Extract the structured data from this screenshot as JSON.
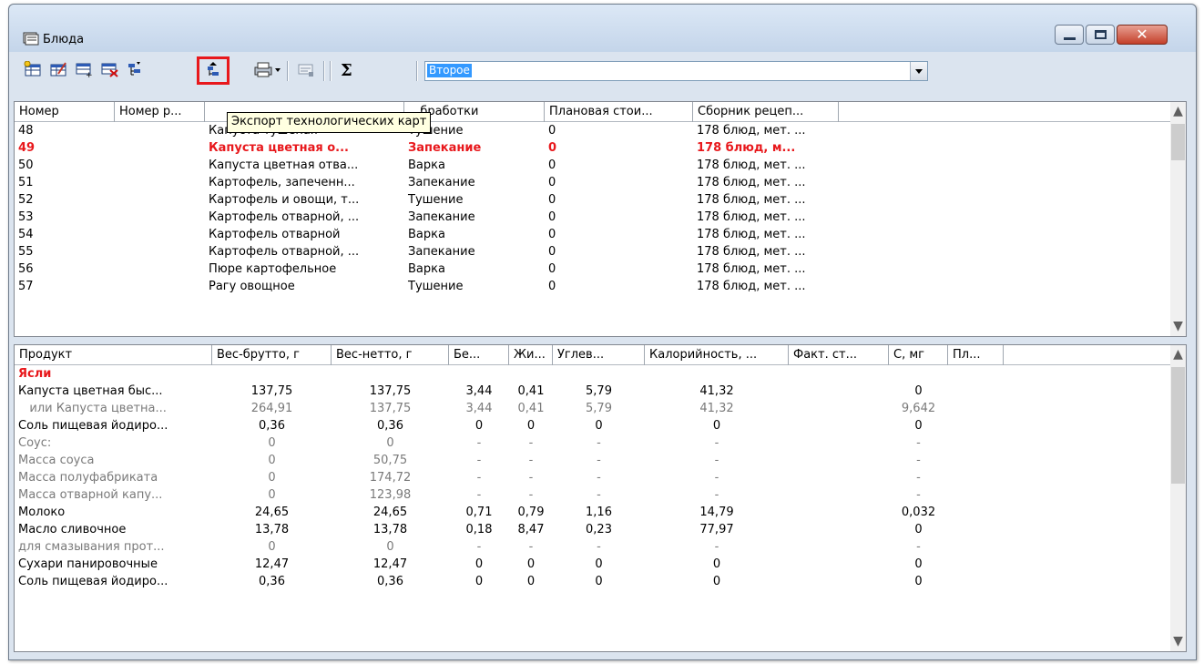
{
  "window": {
    "title": "Блюда",
    "controls": {
      "minimize": "–",
      "maximize": "▫",
      "close": "✕"
    }
  },
  "toolbar": {
    "buttons": [
      {
        "name": "add-dish",
        "icon": "table-add-icon"
      },
      {
        "name": "edit-dish",
        "icon": "table-edit-icon"
      },
      {
        "name": "add-row",
        "icon": "grid-add-icon"
      },
      {
        "name": "delete-dish",
        "icon": "grid-delete-icon"
      },
      {
        "name": "import",
        "icon": "tree-import-icon"
      },
      {
        "name": "export-tech-cards",
        "icon": "tree-export-icon",
        "highlighted": true
      },
      {
        "name": "print",
        "icon": "printer-icon"
      },
      {
        "name": "preview",
        "icon": "preview-icon"
      },
      {
        "name": "sum",
        "icon": "sigma-icon"
      }
    ],
    "filter_combo": {
      "value": "Второе"
    }
  },
  "tooltip": "Экспорт технологических карт",
  "dishes_grid": {
    "columns": [
      "Номер",
      "Номер р...",
      "",
      "...бработки",
      "Плановая стои...",
      "Сборник рецеп..."
    ],
    "rows": [
      {
        "num": "48",
        "rnum": "",
        "name": "Капуста тушеная",
        "method": "Тушение",
        "cost": "0",
        "book": "178 блюд, мет. ...",
        "style": ""
      },
      {
        "num": "49",
        "rnum": "",
        "name": "Капуста цветная о...",
        "method": "Запекание",
        "cost": "0",
        "book": "178 блюд, м...",
        "style": "red"
      },
      {
        "num": "50",
        "rnum": "",
        "name": "Капуста цветная отва...",
        "method": "Варка",
        "cost": "0",
        "book": "178 блюд, мет. ...",
        "style": ""
      },
      {
        "num": "51",
        "rnum": "",
        "name": "Картофель, запеченн...",
        "method": "Запекание",
        "cost": "0",
        "book": "178 блюд, мет. ...",
        "style": ""
      },
      {
        "num": "52",
        "rnum": "",
        "name": "Картофель и овощи, т...",
        "method": "Тушение",
        "cost": "0",
        "book": "178 блюд, мет. ...",
        "style": ""
      },
      {
        "num": "53",
        "rnum": "",
        "name": "Картофель отварной, ...",
        "method": "Запекание",
        "cost": "0",
        "book": "178 блюд, мет. ...",
        "style": ""
      },
      {
        "num": "54",
        "rnum": "",
        "name": "Картофель отварной",
        "method": "Варка",
        "cost": "0",
        "book": "178 блюд, мет. ...",
        "style": ""
      },
      {
        "num": "55",
        "rnum": "",
        "name": "Картофель отварной, ...",
        "method": "Запекание",
        "cost": "0",
        "book": "178 блюд, мет. ...",
        "style": ""
      },
      {
        "num": "56",
        "rnum": "",
        "name": "Пюре картофельное",
        "method": "Варка",
        "cost": "0",
        "book": "178 блюд, мет. ...",
        "style": ""
      },
      {
        "num": "57",
        "rnum": "",
        "name": "Рагу овощное",
        "method": "Тушение",
        "cost": "0",
        "book": "178 блюд, мет. ...",
        "style": ""
      }
    ]
  },
  "products_grid": {
    "columns": [
      "Продукт",
      "Вес-брутто, г",
      "Вес-нетто, г",
      "Бе...",
      "Жи...",
      "Углев...",
      "Калорийность, ...",
      "Факт. ст...",
      "С, мг",
      "Пл..."
    ],
    "rows": [
      {
        "product": "Ясли",
        "brutto": "",
        "netto": "",
        "b": "",
        "zh": "",
        "u": "",
        "kcal": "",
        "fact": "",
        "c": "",
        "style": "section"
      },
      {
        "product": "Капуста цветная быс...",
        "brutto": "137,75",
        "netto": "137,75",
        "b": "3,44",
        "zh": "0,41",
        "u": "5,79",
        "kcal": "41,32",
        "fact": "",
        "c": "0",
        "style": ""
      },
      {
        "product": "   или Капуста цветна...",
        "brutto": "264,91",
        "netto": "137,75",
        "b": "3,44",
        "zh": "0,41",
        "u": "5,79",
        "kcal": "41,32",
        "fact": "",
        "c": "9,642",
        "style": "gray"
      },
      {
        "product": "Соль пищевая йодиро...",
        "brutto": "0,36",
        "netto": "0,36",
        "b": "0",
        "zh": "0",
        "u": "0",
        "kcal": "0",
        "fact": "",
        "c": "0",
        "style": ""
      },
      {
        "product": "Соус:",
        "brutto": "0",
        "netto": "0",
        "b": "-",
        "zh": "-",
        "u": "-",
        "kcal": "-",
        "fact": "",
        "c": "-",
        "style": "gray"
      },
      {
        "product": "Масса соуса",
        "brutto": "0",
        "netto": "50,75",
        "b": "-",
        "zh": "-",
        "u": "-",
        "kcal": "-",
        "fact": "",
        "c": "-",
        "style": "gray"
      },
      {
        "product": "Масса полуфабриката",
        "brutto": "0",
        "netto": "174,72",
        "b": "-",
        "zh": "-",
        "u": "-",
        "kcal": "-",
        "fact": "",
        "c": "-",
        "style": "gray"
      },
      {
        "product": "Масса отварной капу...",
        "brutto": "0",
        "netto": "123,98",
        "b": "-",
        "zh": "-",
        "u": "-",
        "kcal": "-",
        "fact": "",
        "c": "-",
        "style": "gray"
      },
      {
        "product": "Молоко",
        "brutto": "24,65",
        "netto": "24,65",
        "b": "0,71",
        "zh": "0,79",
        "u": "1,16",
        "kcal": "14,79",
        "fact": "",
        "c": "0,032",
        "style": ""
      },
      {
        "product": "Масло сливочное",
        "brutto": "13,78",
        "netto": "13,78",
        "b": "0,18",
        "zh": "8,47",
        "u": "0,23",
        "kcal": "77,97",
        "fact": "",
        "c": "0",
        "style": ""
      },
      {
        "product": "для смазывания прот...",
        "brutto": "0",
        "netto": "0",
        "b": "-",
        "zh": "-",
        "u": "-",
        "kcal": "-",
        "fact": "",
        "c": "-",
        "style": "gray"
      },
      {
        "product": "Сухари панировочные",
        "brutto": "12,47",
        "netto": "12,47",
        "b": "0",
        "zh": "0",
        "u": "0",
        "kcal": "0",
        "fact": "",
        "c": "0",
        "style": ""
      },
      {
        "product": "Соль пищевая йодиро...",
        "brutto": "0,36",
        "netto": "0,36",
        "b": "0",
        "zh": "0",
        "u": "0",
        "kcal": "0",
        "fact": "",
        "c": "0",
        "style": ""
      }
    ]
  },
  "scrollbar": {
    "up": "▲",
    "down": "▼"
  }
}
